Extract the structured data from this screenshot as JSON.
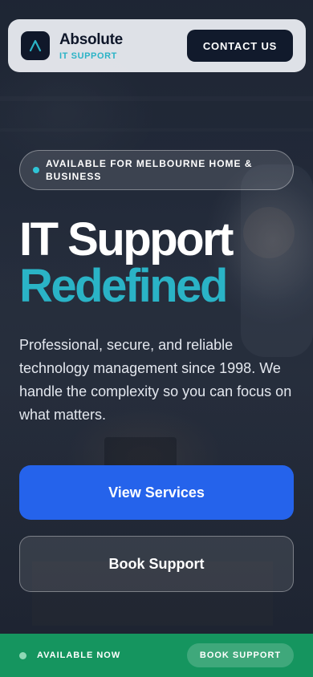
{
  "brand": {
    "name": "Absolute",
    "tagline": "IT SUPPORT",
    "logo_icon": "caret-up-icon"
  },
  "header": {
    "contact_label": "CONTACT US"
  },
  "hero": {
    "availability": "AVAILABLE FOR MELBOURNE HOME & BUSINESS",
    "headline_line1": "IT Support",
    "headline_line2": "Redefined",
    "description": "Professional, secure, and reliable technology management since 1998. We handle the complexity so you can focus on what matters.",
    "primary_cta": "View Services",
    "secondary_cta": "Book Support"
  },
  "bottom_bar": {
    "status": "AVAILABLE NOW",
    "button": "BOOK SUPPORT"
  },
  "colors": {
    "accent_teal": "#2ab3c6",
    "primary_blue": "#2563eb",
    "bar_green": "#15955f",
    "dark_navy": "#111a2c"
  }
}
